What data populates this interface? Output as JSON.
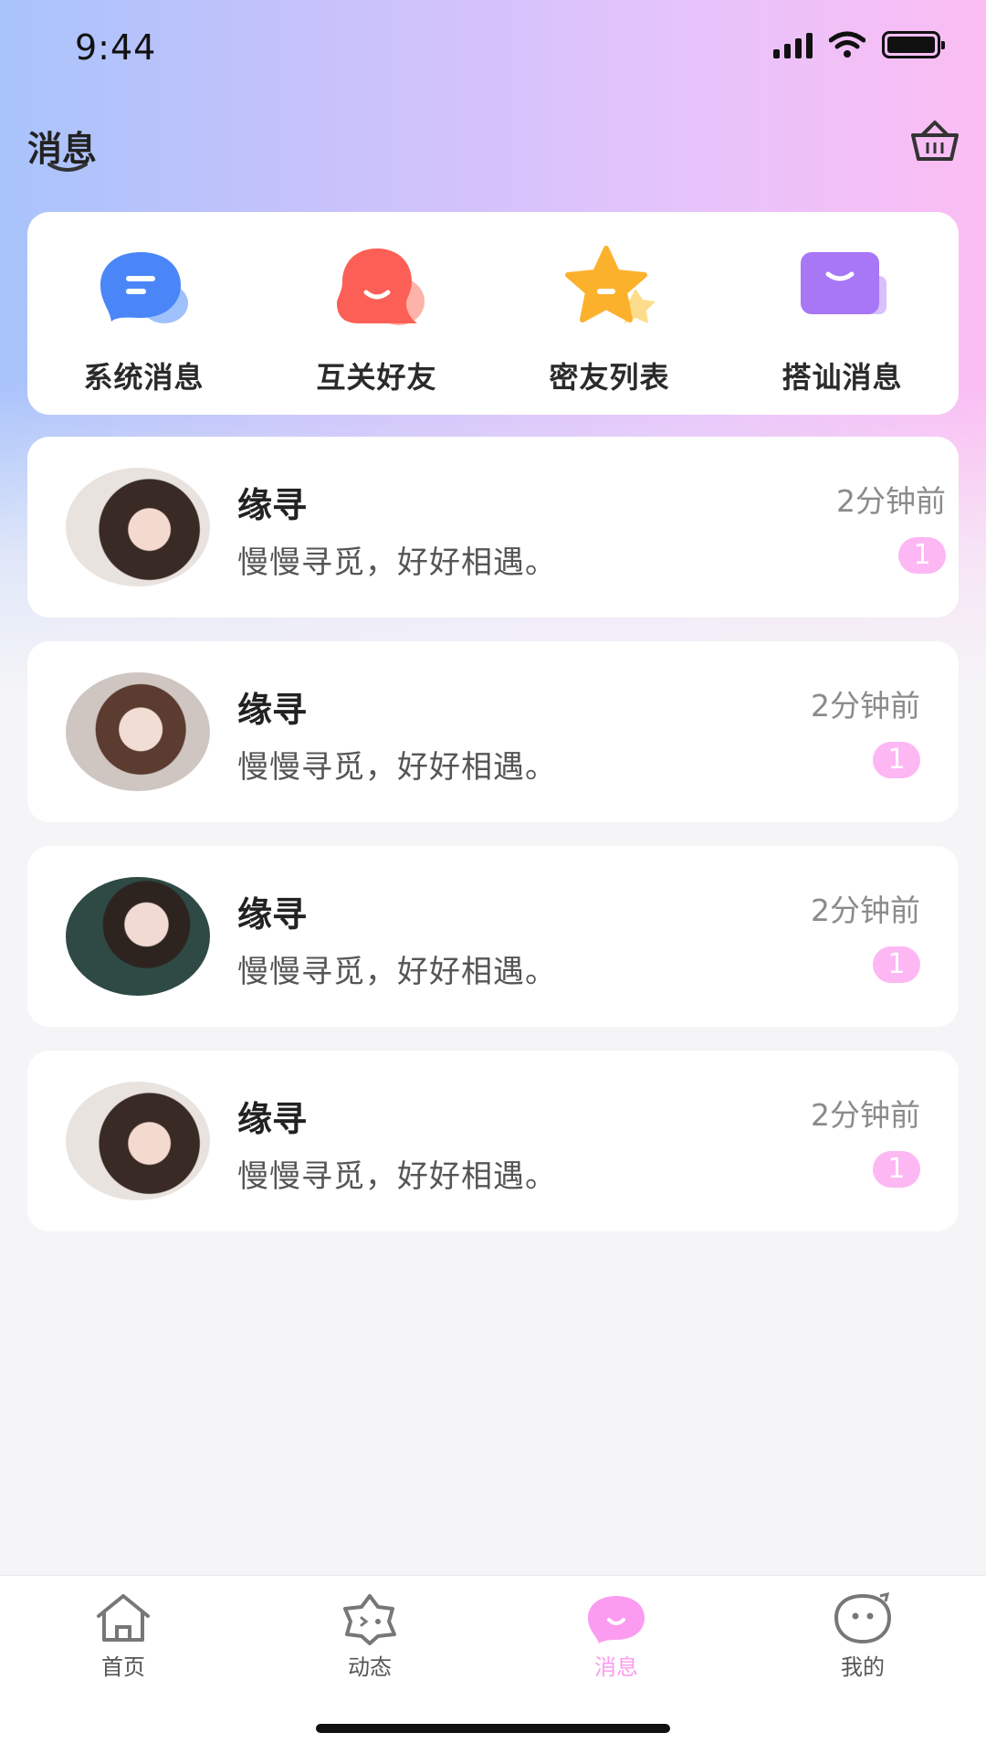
{
  "status_bar": {
    "time": "9:44"
  },
  "header": {
    "title": "消息",
    "action_icon": "basket-icon"
  },
  "quick_actions": [
    {
      "label": "系统消息",
      "icon": "system-message-icon",
      "color": "#4a86f7"
    },
    {
      "label": "互关好友",
      "icon": "mutual-friends-icon",
      "color": "#fb5f55"
    },
    {
      "label": "密友列表",
      "icon": "star-icon",
      "color": "#fbb12b"
    },
    {
      "label": "搭讪消息",
      "icon": "chat-up-icon",
      "color": "#a777f6"
    }
  ],
  "messages": [
    {
      "name": "缘寻",
      "preview": "慢慢寻觅，好好相遇。",
      "time": "2分钟前",
      "unread": "1"
    },
    {
      "name": "缘寻",
      "preview": "慢慢寻觅，好好相遇。",
      "time": "2分钟前",
      "unread": "1"
    },
    {
      "name": "缘寻",
      "preview": "慢慢寻觅，好好相遇。",
      "time": "2分钟前",
      "unread": "1"
    },
    {
      "name": "缘寻",
      "preview": "慢慢寻觅，好好相遇。",
      "time": "2分钟前",
      "unread": "1"
    }
  ],
  "tabs": [
    {
      "label": "首页",
      "icon": "home-icon"
    },
    {
      "label": "动态",
      "icon": "moments-icon"
    },
    {
      "label": "消息",
      "icon": "message-icon",
      "active": true
    },
    {
      "label": "我的",
      "icon": "profile-icon"
    }
  ],
  "colors": {
    "accent": "#fc9cf0",
    "badge": "#fdb7f3"
  }
}
